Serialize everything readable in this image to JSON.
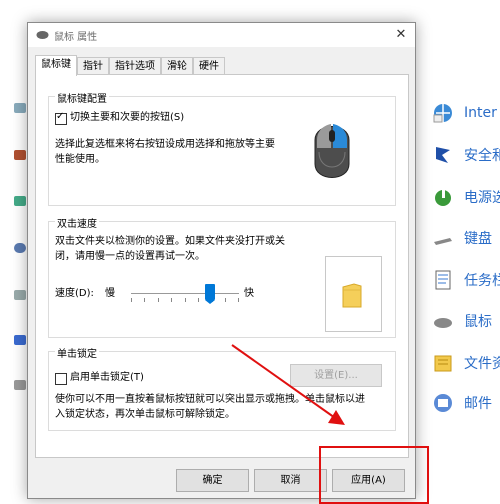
{
  "background": {
    "items": [
      {
        "label": "Inter",
        "icon": "globe-icon"
      },
      {
        "label": "安全和",
        "icon": "flag-icon"
      },
      {
        "label": "电源选",
        "icon": "power-icon"
      },
      {
        "label": "键盘",
        "icon": "keyboard-icon"
      },
      {
        "label": "任务栏",
        "icon": "taskbar-icon"
      },
      {
        "label": "鼠标",
        "icon": "mouse-icon"
      },
      {
        "label": "文件资",
        "icon": "folder-icon"
      },
      {
        "label": "邮件",
        "icon": "mail-icon"
      }
    ]
  },
  "dialog": {
    "title": "鼠标 属性",
    "close_glyph": "✕",
    "tabs": [
      "鼠标键",
      "指针",
      "指针选项",
      "滑轮",
      "硬件"
    ],
    "active_tab": "鼠标键",
    "button_config": {
      "legend": "鼠标键配置",
      "checkbox_label": "切换主要和次要的按钮(S)",
      "checked": true,
      "description_1": "选择此复选框来将右按钮设成用选择和拖放等主要",
      "description_2": "性能使用。"
    },
    "double_click": {
      "legend": "双击速度",
      "description_1": "双击文件夹以检测你的设置。如果文件夹没打开或关",
      "description_2": "闭，请用慢一点的设置再试一次。",
      "speed_label": "速度(D):",
      "slow_label": "慢",
      "fast_label": "快",
      "speed_level": 0.75
    },
    "click_lock": {
      "legend": "单击锁定",
      "checkbox_label": "启用单击锁定(T)",
      "checked": false,
      "settings_button": "设置(E)...",
      "description_1": "使你可以不用一直按着鼠标按钮就可以突出显示或拖拽。单击鼠标以进",
      "description_2": "入锁定状态，再次单击鼠标可解除锁定。"
    },
    "buttons": {
      "ok": "确定",
      "cancel": "取消",
      "apply": "应用(A)"
    }
  },
  "annotation": {
    "arrow_color": "#e01010",
    "box_color": "#e01010"
  }
}
